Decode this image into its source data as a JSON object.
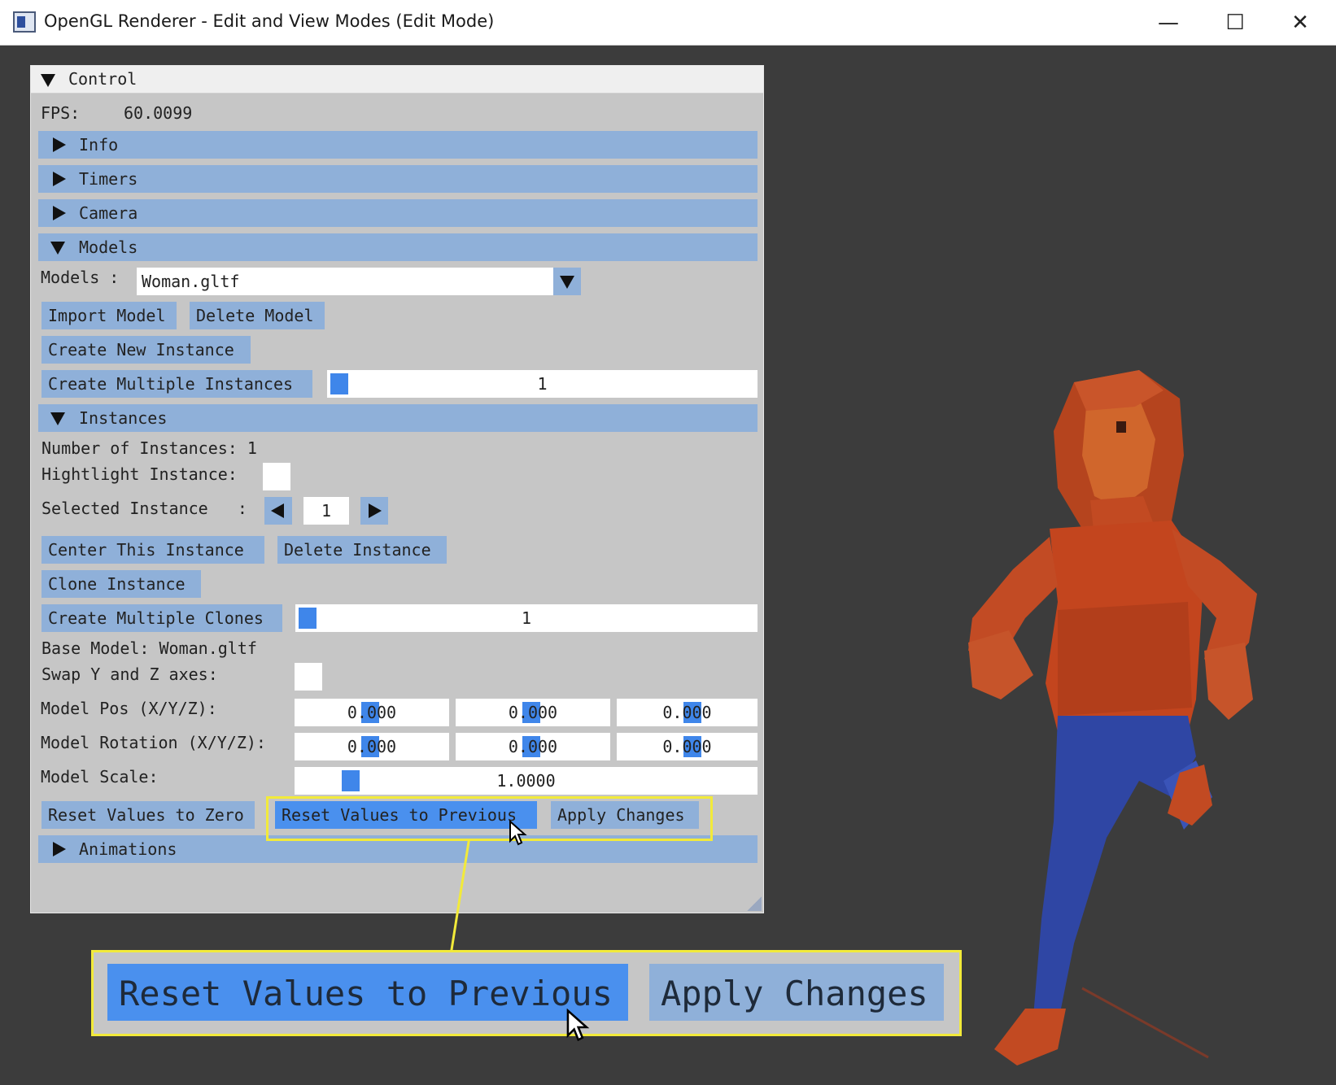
{
  "window": {
    "title": "OpenGL Renderer - Edit and View Modes (Edit Mode)",
    "minimize_glyph": "—",
    "maximize_glyph": "☐",
    "close_glyph": "✕"
  },
  "control": {
    "header": "Control",
    "fps_label": "FPS:",
    "fps_value": "60.0099",
    "sections": {
      "info": "Info",
      "timers": "Timers",
      "camera": "Camera",
      "models": "Models",
      "instances": "Instances",
      "animations": "Animations"
    },
    "models": {
      "label": "Models :",
      "selected": "Woman.gltf",
      "import_button": "Import Model",
      "delete_button": "Delete Model",
      "create_instance_button": "Create New Instance",
      "create_multiple_button": "Create Multiple Instances",
      "multiple_count": "1"
    },
    "instances": {
      "count_text": "Number of Instances: 1",
      "highlight_label": "Hightlight Instance:",
      "selected_label": "Selected Instance   :",
      "selected_value": "1",
      "center_button": "Center This Instance",
      "delete_button": "Delete Instance",
      "clone_button": "Clone Instance",
      "clones_button": "Create Multiple Clones",
      "clones_count": "1",
      "base_model_text": "Base Model: Woman.gltf",
      "swap_axes_label": "Swap Y and Z axes:",
      "pos_label": "Model Pos (X/Y/Z):",
      "pos_values": [
        "0.000",
        "0.000",
        "0.000"
      ],
      "rot_label": "Model Rotation (X/Y/Z):",
      "rot_values": [
        "0.000",
        "0.000",
        "0.000"
      ],
      "scale_label": "Model Scale:",
      "scale_value": "1.0000",
      "reset_zero_button": "Reset Values to Zero",
      "reset_prev_button": "Reset Values to Previous",
      "apply_button": "Apply Changes"
    }
  },
  "zoom": {
    "reset_prev_button": "Reset Values to Previous",
    "apply_button": "Apply Changes"
  },
  "colors": {
    "panel_bg": "#c6c6c6",
    "header_blue": "#8fb0d9",
    "active_blue": "#4a90ee",
    "highlight_yellow": "#f2ea3a",
    "viewport_bg": "#3c3c3c"
  }
}
